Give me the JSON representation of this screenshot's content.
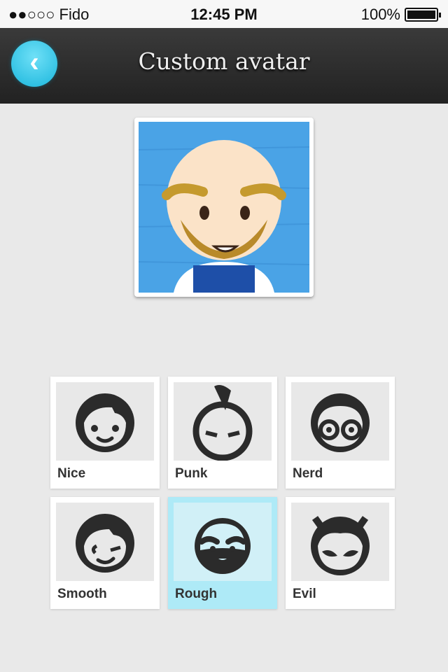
{
  "status_bar": {
    "carrier": "●●○○○ Fido",
    "time": "12:45 PM",
    "battery": "100%"
  },
  "header": {
    "title": "Custom avatar",
    "back_icon": "chevron-left-icon"
  },
  "accent_color": "#1ab6dc",
  "avatar_options": [
    {
      "label": "Nice",
      "selected": false
    },
    {
      "label": "Punk",
      "selected": false
    },
    {
      "label": "Nerd",
      "selected": false
    },
    {
      "label": "Smooth",
      "selected": false
    },
    {
      "label": "Rough",
      "selected": true
    },
    {
      "label": "Evil",
      "selected": false
    }
  ]
}
